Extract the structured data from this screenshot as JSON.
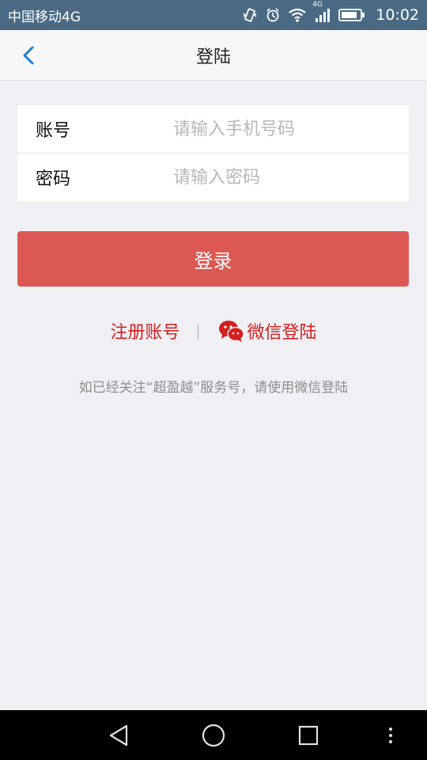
{
  "status_bar": {
    "carrier": "中国移动4G",
    "network_label": "4G",
    "time": "10:02"
  },
  "nav": {
    "title": "登陆",
    "back_icon": "chevron-left-icon"
  },
  "form": {
    "account": {
      "label": "账号",
      "placeholder": "请输入手机号码",
      "value": ""
    },
    "password": {
      "label": "密码",
      "placeholder": "请输入密码",
      "value": ""
    }
  },
  "login_button": {
    "label": "登录"
  },
  "links": {
    "register": "注册账号",
    "separator": "|",
    "wechat_login": "微信登陆"
  },
  "hint": "如已经关注“超盈越”服务号，请使用微信登陆",
  "colors": {
    "status_bar": "#4a6a84",
    "accent_red": "#dc5953",
    "link_red": "#d31f1f",
    "back_icon_blue": "#1a7fd4",
    "background": "#efeff4"
  }
}
